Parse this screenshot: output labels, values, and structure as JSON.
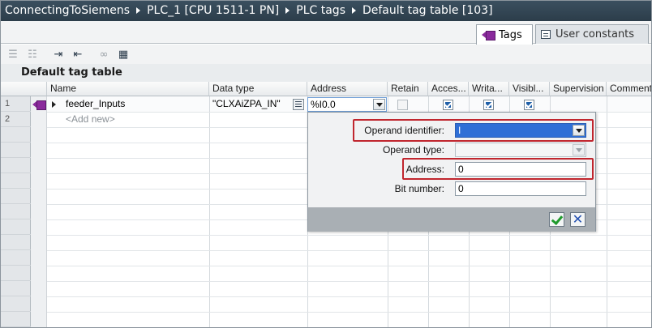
{
  "breadcrumb": [
    "ConnectingToSiemens",
    "PLC_1 [CPU 1511-1 PN]",
    "PLC tags",
    "Default tag table [103]"
  ],
  "tabs": {
    "tags": "Tags",
    "user_constants": "User constants"
  },
  "table_title": "Default tag table",
  "columns": {
    "name": "Name",
    "data_type": "Data type",
    "address": "Address",
    "retain": "Retain",
    "accessible": "Acces...",
    "writable": "Writa...",
    "visible": "Visibl...",
    "supervision": "Supervision",
    "comment": "Comment"
  },
  "rows": [
    {
      "num": "1",
      "name": "feeder_Inputs",
      "data_type": "\"CLXAiZPA_IN\"",
      "address": "%I0.0",
      "retain": false,
      "accessible": true,
      "writable": true,
      "visible": true
    },
    {
      "num": "2",
      "name": "<Add new>"
    }
  ],
  "popup": {
    "operand_identifier_label": "Operand identifier:",
    "operand_identifier_value": "I",
    "operand_type_label": "Operand type:",
    "operand_type_value": "",
    "address_label": "Address:",
    "address_value": "0",
    "bit_number_label": "Bit number:",
    "bit_number_value": "0"
  },
  "colors": {
    "highlight_box": "#c0262e",
    "selection": "#2f6fd6",
    "header_bar": "#34485a"
  }
}
